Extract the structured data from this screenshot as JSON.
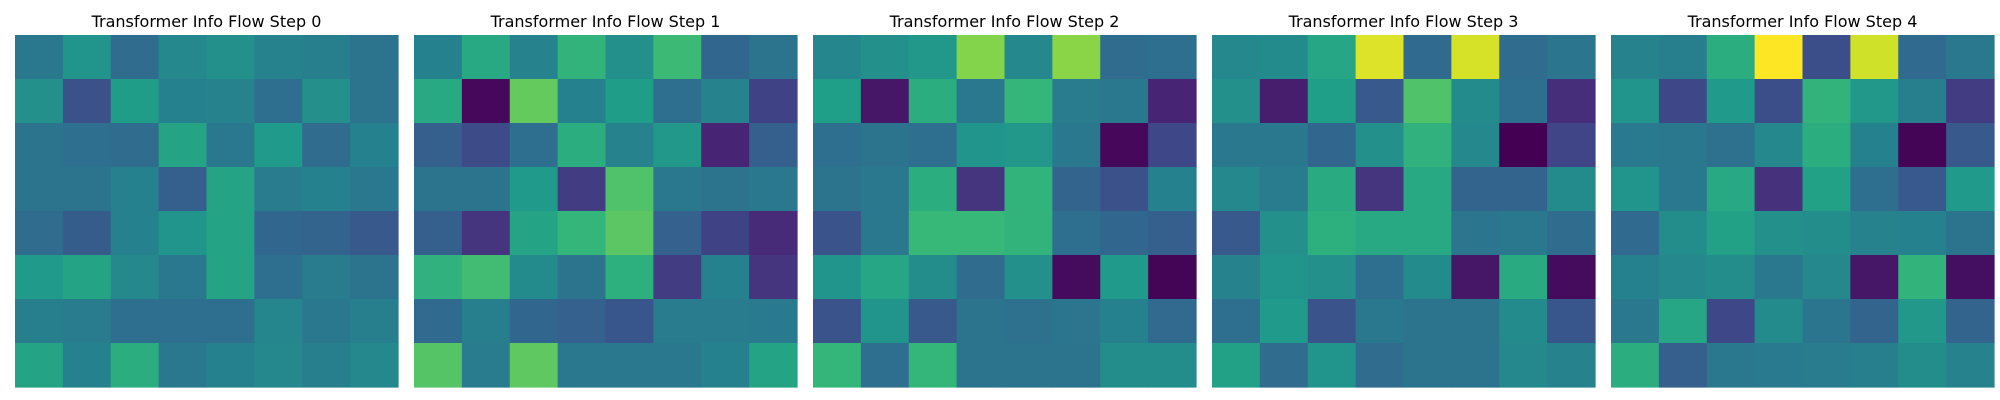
{
  "figure": {
    "colormap": "viridis",
    "colormap_stops": [
      "#440154",
      "#482878",
      "#3e4989",
      "#31688e",
      "#26828e",
      "#1f9e89",
      "#35b779",
      "#6ece58",
      "#b5de2b",
      "#fde725"
    ]
  },
  "chart_data": [
    {
      "type": "heatmap",
      "title": "Transformer Info Flow Step 0",
      "rows": 8,
      "cols": 8,
      "vmin": 0,
      "vmax": 1,
      "values": [
        [
          0.4,
          0.52,
          0.35,
          0.47,
          0.5,
          0.45,
          0.43,
          0.38
        ],
        [
          0.5,
          0.25,
          0.55,
          0.44,
          0.45,
          0.36,
          0.5,
          0.38
        ],
        [
          0.38,
          0.36,
          0.35,
          0.58,
          0.4,
          0.54,
          0.35,
          0.44
        ],
        [
          0.38,
          0.38,
          0.44,
          0.3,
          0.58,
          0.42,
          0.44,
          0.4
        ],
        [
          0.35,
          0.29,
          0.44,
          0.52,
          0.58,
          0.33,
          0.32,
          0.28
        ],
        [
          0.54,
          0.58,
          0.47,
          0.4,
          0.58,
          0.36,
          0.42,
          0.38
        ],
        [
          0.43,
          0.42,
          0.36,
          0.36,
          0.36,
          0.46,
          0.4,
          0.43
        ],
        [
          0.58,
          0.44,
          0.62,
          0.4,
          0.44,
          0.47,
          0.43,
          0.47
        ]
      ]
    },
    {
      "type": "heatmap",
      "title": "Transformer Info Flow Step 1",
      "rows": 8,
      "cols": 8,
      "vmin": 0,
      "vmax": 1,
      "values": [
        [
          0.44,
          0.6,
          0.45,
          0.65,
          0.5,
          0.68,
          0.33,
          0.38
        ],
        [
          0.6,
          0.02,
          0.76,
          0.44,
          0.55,
          0.36,
          0.45,
          0.2
        ],
        [
          0.3,
          0.23,
          0.36,
          0.62,
          0.45,
          0.53,
          0.1,
          0.3
        ],
        [
          0.38,
          0.38,
          0.54,
          0.18,
          0.72,
          0.4,
          0.38,
          0.4
        ],
        [
          0.3,
          0.15,
          0.58,
          0.66,
          0.74,
          0.31,
          0.2,
          0.12
        ],
        [
          0.64,
          0.69,
          0.48,
          0.38,
          0.63,
          0.18,
          0.44,
          0.15
        ],
        [
          0.34,
          0.43,
          0.33,
          0.31,
          0.27,
          0.42,
          0.42,
          0.41
        ],
        [
          0.73,
          0.42,
          0.75,
          0.4,
          0.4,
          0.4,
          0.44,
          0.58
        ]
      ]
    },
    {
      "type": "heatmap",
      "title": "Transformer Info Flow Step 2",
      "rows": 8,
      "cols": 8,
      "vmin": 0,
      "vmax": 1,
      "values": [
        [
          0.46,
          0.5,
          0.53,
          0.81,
          0.47,
          0.82,
          0.35,
          0.36
        ],
        [
          0.56,
          0.06,
          0.62,
          0.4,
          0.66,
          0.42,
          0.4,
          0.1
        ],
        [
          0.36,
          0.38,
          0.36,
          0.52,
          0.53,
          0.4,
          0.02,
          0.22
        ],
        [
          0.38,
          0.4,
          0.62,
          0.15,
          0.65,
          0.32,
          0.25,
          0.44
        ],
        [
          0.26,
          0.4,
          0.67,
          0.67,
          0.65,
          0.36,
          0.33,
          0.3
        ],
        [
          0.52,
          0.59,
          0.49,
          0.35,
          0.5,
          0.03,
          0.54,
          0.01
        ],
        [
          0.26,
          0.52,
          0.28,
          0.38,
          0.37,
          0.39,
          0.44,
          0.34
        ],
        [
          0.66,
          0.36,
          0.66,
          0.38,
          0.38,
          0.38,
          0.49,
          0.49
        ]
      ]
    },
    {
      "type": "heatmap",
      "title": "Transformer Info Flow Step 3",
      "rows": 8,
      "cols": 8,
      "vmin": 0,
      "vmax": 1,
      "values": [
        [
          0.47,
          0.48,
          0.59,
          0.95,
          0.34,
          0.94,
          0.35,
          0.39
        ],
        [
          0.5,
          0.08,
          0.56,
          0.28,
          0.72,
          0.48,
          0.36,
          0.13
        ],
        [
          0.4,
          0.4,
          0.33,
          0.5,
          0.64,
          0.47,
          0.0,
          0.21
        ],
        [
          0.47,
          0.42,
          0.61,
          0.15,
          0.6,
          0.32,
          0.32,
          0.48
        ],
        [
          0.28,
          0.5,
          0.63,
          0.6,
          0.6,
          0.39,
          0.4,
          0.35
        ],
        [
          0.45,
          0.52,
          0.5,
          0.36,
          0.48,
          0.06,
          0.61,
          0.03
        ],
        [
          0.36,
          0.54,
          0.26,
          0.4,
          0.38,
          0.38,
          0.48,
          0.27
        ],
        [
          0.57,
          0.35,
          0.52,
          0.35,
          0.38,
          0.38,
          0.47,
          0.45
        ]
      ]
    },
    {
      "type": "heatmap",
      "title": "Transformer Info Flow Step 4",
      "rows": 8,
      "cols": 8,
      "vmin": 0,
      "vmax": 1,
      "values": [
        [
          0.45,
          0.43,
          0.62,
          1.0,
          0.24,
          0.93,
          0.34,
          0.4
        ],
        [
          0.52,
          0.22,
          0.54,
          0.24,
          0.65,
          0.53,
          0.43,
          0.18
        ],
        [
          0.41,
          0.4,
          0.37,
          0.47,
          0.62,
          0.44,
          0.01,
          0.28
        ],
        [
          0.52,
          0.4,
          0.6,
          0.14,
          0.57,
          0.36,
          0.28,
          0.54
        ],
        [
          0.34,
          0.49,
          0.57,
          0.5,
          0.49,
          0.45,
          0.44,
          0.38
        ],
        [
          0.44,
          0.47,
          0.49,
          0.4,
          0.47,
          0.06,
          0.65,
          0.04
        ],
        [
          0.4,
          0.59,
          0.22,
          0.48,
          0.39,
          0.32,
          0.53,
          0.32
        ],
        [
          0.62,
          0.3,
          0.4,
          0.41,
          0.42,
          0.43,
          0.49,
          0.45
        ]
      ]
    }
  ]
}
